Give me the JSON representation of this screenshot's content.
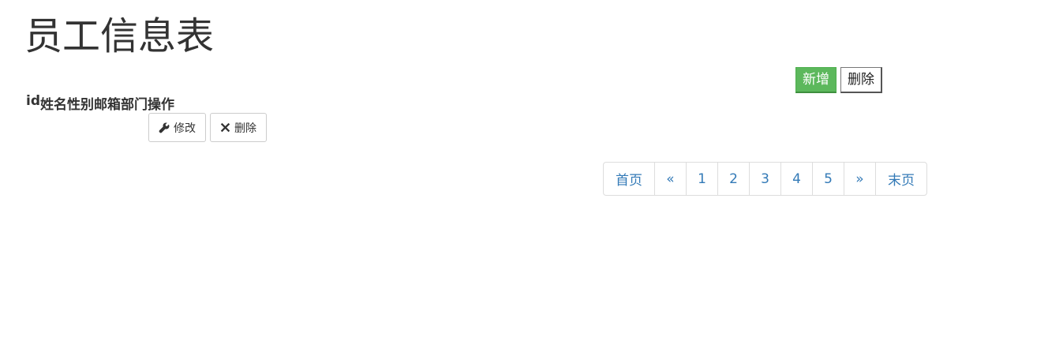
{
  "page": {
    "title": "员工信息表"
  },
  "toolbar": {
    "add_label": "新增",
    "delete_label": "删除"
  },
  "table": {
    "headers": [
      "id",
      "姓名",
      "性别",
      "邮箱",
      "部门",
      "操作"
    ]
  },
  "row_actions": {
    "edit_label": "修改",
    "delete_label": "删除",
    "edit_icon": "wrench-icon",
    "delete_icon": "close-icon"
  },
  "pagination": {
    "first": "首页",
    "prev": "«",
    "pages": [
      "1",
      "2",
      "3",
      "4",
      "5"
    ],
    "next": "»",
    "last": "末页"
  },
  "colors": {
    "success": "#5cb85c",
    "link": "#337ab7"
  }
}
